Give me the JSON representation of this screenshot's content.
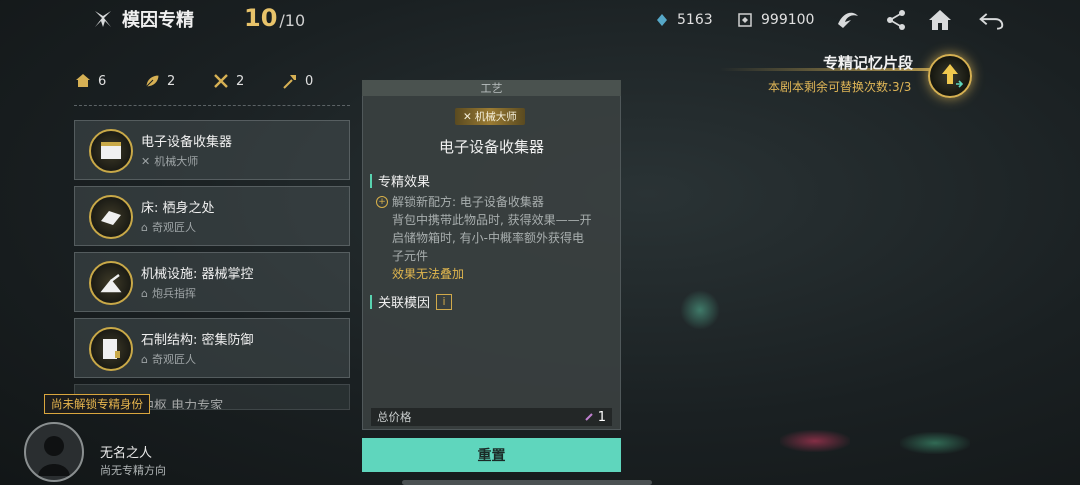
{
  "header": {
    "title": "模因专精",
    "progress_current": "10",
    "progress_total": "/10",
    "resources": [
      {
        "icon": "gem-icon",
        "value": "5163"
      },
      {
        "icon": "currency-box-icon",
        "value": "999100"
      }
    ],
    "icons": [
      "emblem-icon",
      "share-icon",
      "home-icon",
      "back-icon"
    ]
  },
  "memory_fragment": {
    "title": "专精记忆片段",
    "subtitle": "本剧本剩余可替换次数:3/3"
  },
  "stats": [
    {
      "icon": "house-icon",
      "value": "6"
    },
    {
      "icon": "leaf-icon",
      "value": "2"
    },
    {
      "icon": "tools-icon",
      "value": "2"
    },
    {
      "icon": "hammer-icon",
      "value": "0"
    }
  ],
  "list": [
    {
      "title": "电子设备收集器",
      "sub": "机械大师",
      "sub_icon": "tools-icon"
    },
    {
      "title": "床: 栖身之处",
      "sub": "奇观匠人",
      "sub_icon": "house-icon"
    },
    {
      "title": "机械设施: 器械掌控",
      "sub": "炮兵指挥",
      "sub_icon": "house-icon"
    },
    {
      "title": "石制结构: 密集防御",
      "sub": "奇观匠人",
      "sub_icon": "house-icon"
    },
    {
      "title": "中枢 电力专家",
      "sub": "",
      "sub_icon": ""
    }
  ],
  "user": {
    "lock_badge": "尚未解锁专精身份",
    "name": "无名之人",
    "sub": "尚无专精方向"
  },
  "panel": {
    "header": "工艺",
    "badge": "机械大师",
    "title": "电子设备收集器",
    "section_effect": "专精效果",
    "effect_first": "解锁新配方: 电子设备收集器",
    "effect_lines": [
      "背包中携带此物品时, 获得效果——开",
      "启储物箱时, 有小-中概率额外获得电",
      "子元件"
    ],
    "effect_note": "效果无法叠加",
    "section_related": "关联模因",
    "price_label": "总价格",
    "price_value": "1",
    "reset_label": "重置"
  },
  "colors": {
    "accent_gold": "#e0b657",
    "accent_teal": "#5fd6bd"
  }
}
